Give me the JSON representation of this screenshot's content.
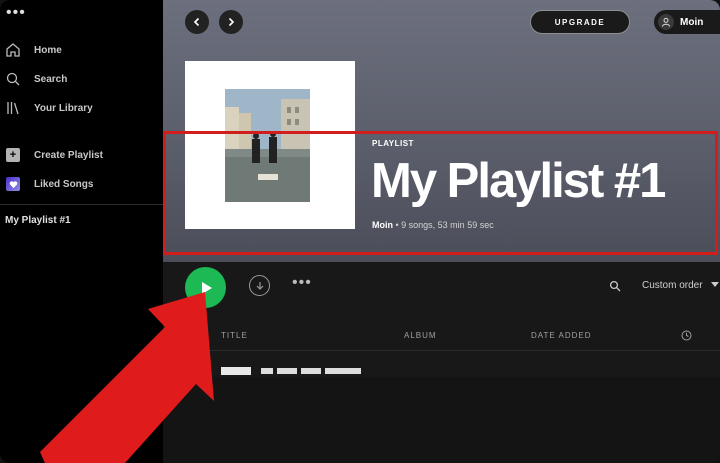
{
  "window": {
    "menu_dots": "•••"
  },
  "sidebar": {
    "items": [
      {
        "label": "Home",
        "icon": "home-icon"
      },
      {
        "label": "Search",
        "icon": "search-icon"
      },
      {
        "label": "Your Library",
        "icon": "library-icon"
      }
    ],
    "create_playlist": "Create Playlist",
    "liked_songs": "Liked Songs",
    "playlists": [
      "My Playlist #1"
    ]
  },
  "header": {
    "upgrade_label": "UPGRADE",
    "user_name": "Moin"
  },
  "playlist": {
    "type_label": "PLAYLIST",
    "title": "My Playlist #1",
    "owner": "Moin",
    "details": " • 9 songs, 53 min 59 sec"
  },
  "toolbar": {
    "more_label": "•••",
    "sort_label": "Custom order"
  },
  "table": {
    "columns": [
      "TITLE",
      "ALBUM",
      "DATE ADDED"
    ]
  },
  "colors": {
    "accent": "#1db954",
    "highlight_box": "#d21d1d",
    "annotation_arrow": "#e01b1b"
  }
}
